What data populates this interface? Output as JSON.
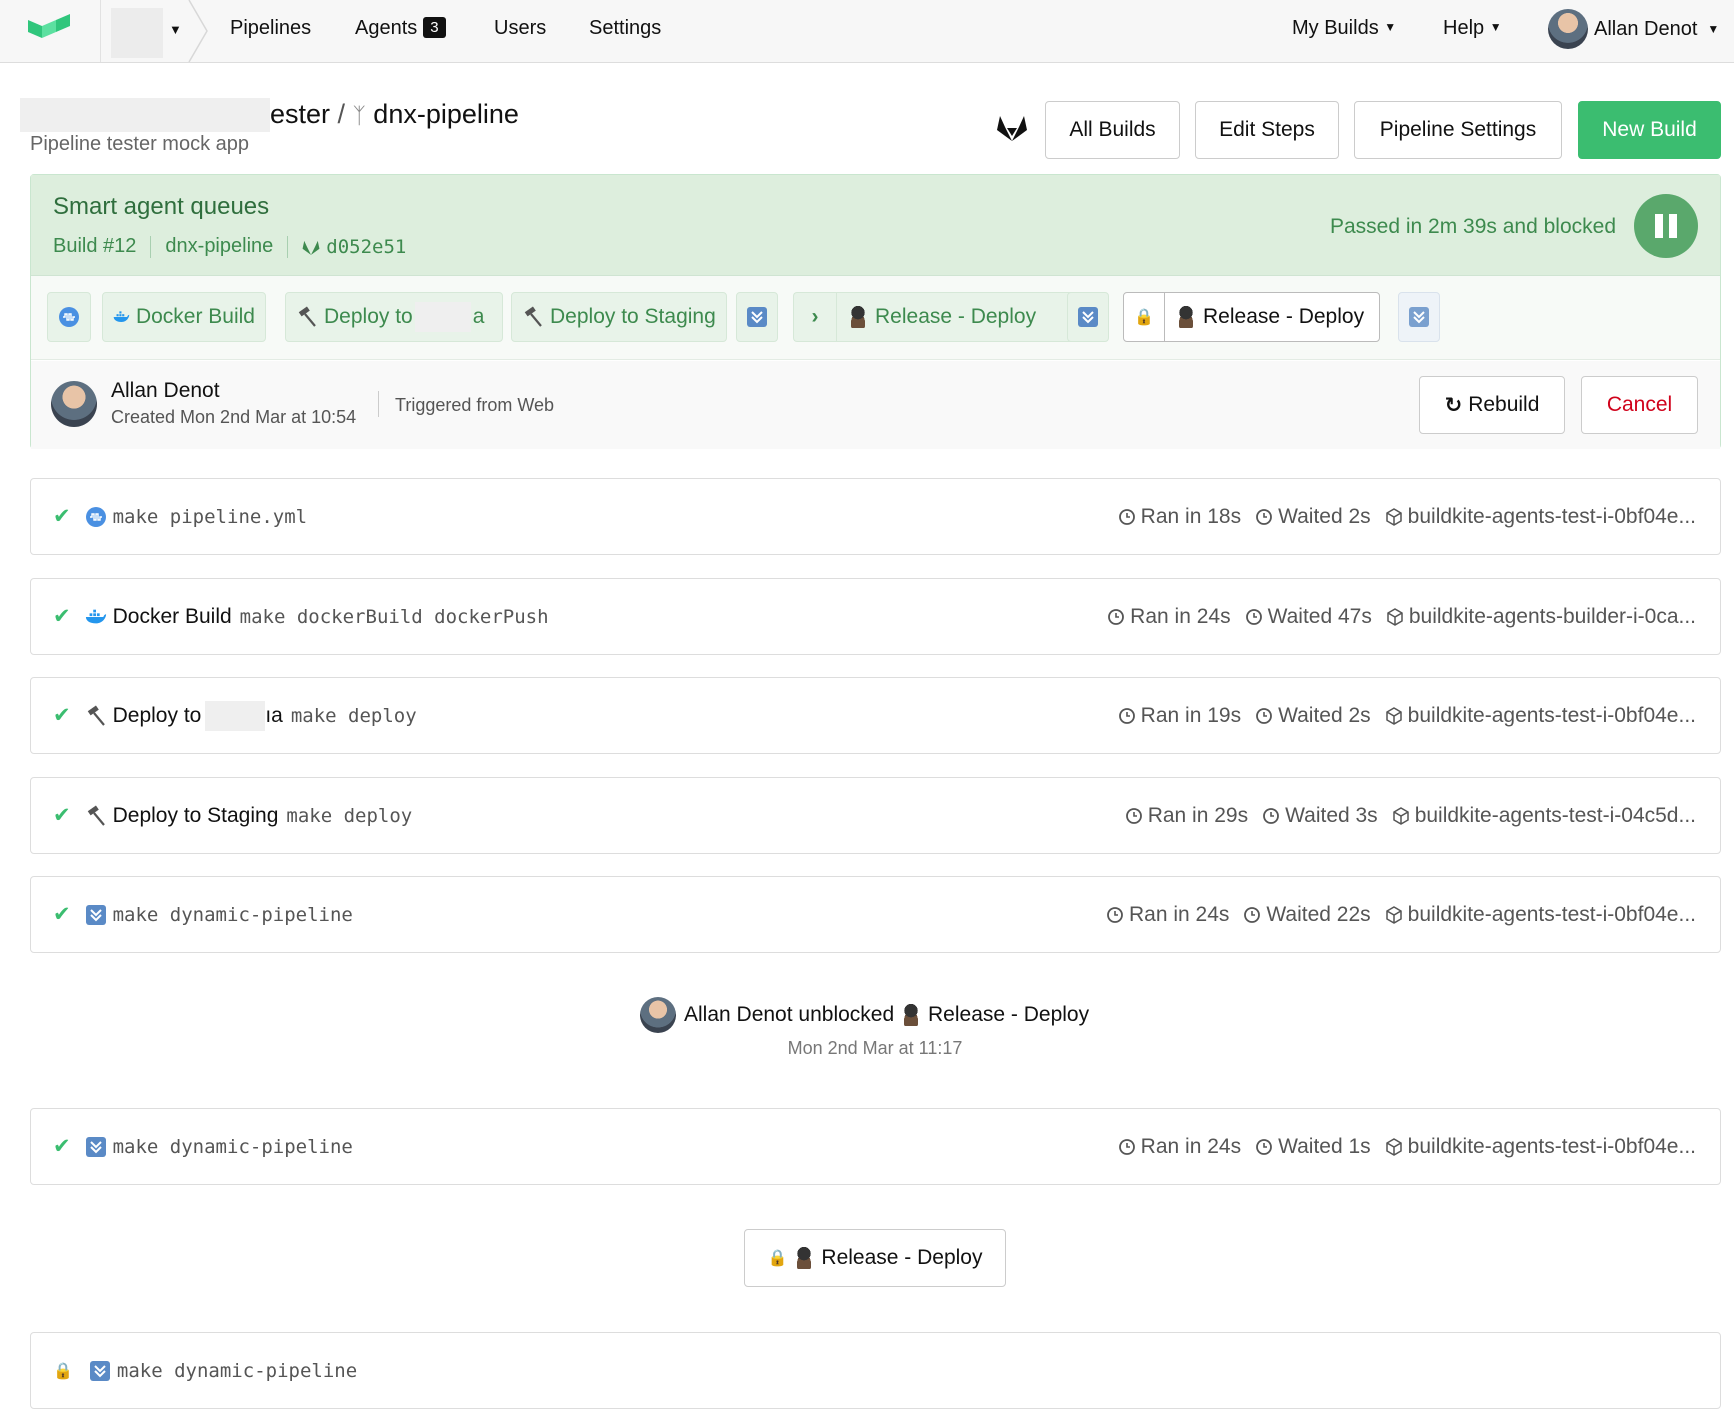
{
  "nav": {
    "links": [
      "Pipelines",
      "Agents",
      "Users",
      "Settings"
    ],
    "agents_count": "3",
    "my_builds": "My Builds",
    "help": "Help",
    "user_name": "Allan Denot"
  },
  "header": {
    "breadcrumb_org_suffix": "ester",
    "breadcrumb_sep": "/",
    "pipeline_name": "dnx-pipeline",
    "subtitle": "Pipeline tester mock app",
    "buttons": {
      "all_builds": "All Builds",
      "edit_steps": "Edit Steps",
      "pipeline_settings": "Pipeline Settings",
      "new_build": "New Build"
    }
  },
  "build": {
    "title": "Smart agent queues",
    "number": "Build #12",
    "branch": "dnx-pipeline",
    "commit": "d052e51",
    "status": "Passed in 2m 39s and blocked",
    "colors": {
      "passed_bg": "#ddeedd",
      "passed_text": "#3d8a4e",
      "accent": "#3bbd70",
      "cancel": "#d0021b"
    },
    "pipeline_steps": {
      "docker_build": "Docker Build",
      "deploy_to_prefix": "Deploy to",
      "deploy_to_suffix": "a",
      "deploy_to_staging": "Deploy to Staging",
      "release_deploy": "Release - Deploy",
      "release_deploy_blocked": "Release - Deploy"
    },
    "triggered_by": "Allan Denot",
    "created": "Created Mon 2nd Mar at 10:54",
    "trigger_source": "Triggered from Web",
    "rebuild": "Rebuild",
    "cancel": "Cancel"
  },
  "jobs": [
    {
      "label": "",
      "command": "make pipeline.yml",
      "ran": "Ran in 18s",
      "waited": "Waited 2s",
      "agent": "buildkite-agents-test-i-0bf04e..."
    },
    {
      "label": "Docker Build",
      "command": "make dockerBuild dockerPush",
      "ran": "Ran in 24s",
      "waited": "Waited 47s",
      "agent": "buildkite-agents-builder-i-0ca..."
    },
    {
      "label": "Deploy to",
      "label_suffix": "ıa",
      "command": "make deploy",
      "ran": "Ran in 19s",
      "waited": "Waited 2s",
      "agent": "buildkite-agents-test-i-0bf04e..."
    },
    {
      "label": "Deploy to Staging",
      "command": "make deploy",
      "ran": "Ran in 29s",
      "waited": "Waited 3s",
      "agent": "buildkite-agents-test-i-04c5d..."
    },
    {
      "label": "",
      "command": "make dynamic-pipeline",
      "ran": "Ran in 24s",
      "waited": "Waited 22s",
      "agent": "buildkite-agents-test-i-0bf04e..."
    },
    {
      "label": "",
      "command": "make dynamic-pipeline",
      "ran": "Ran in 24s",
      "waited": "Waited 1s",
      "agent": "buildkite-agents-test-i-0bf04e..."
    },
    {
      "label": "",
      "command": "make dynamic-pipeline"
    }
  ],
  "unblock": {
    "user": "Allan Denot",
    "verb": "unblocked",
    "step": "Release - Deploy",
    "date": "Mon 2nd Mar at 11:17"
  },
  "release_button": "Release - Deploy",
  "icons": [
    "buildkite-logo-icon",
    "caret-down-icon",
    "branch-icon",
    "gitlab-icon",
    "pause-icon",
    "docker-icon",
    "hammer-icon",
    "spy-icon",
    "download-icon",
    "lock-icon",
    "chevron-right-icon",
    "refresh-icon",
    "check-icon",
    "clock-icon",
    "box-icon"
  ]
}
